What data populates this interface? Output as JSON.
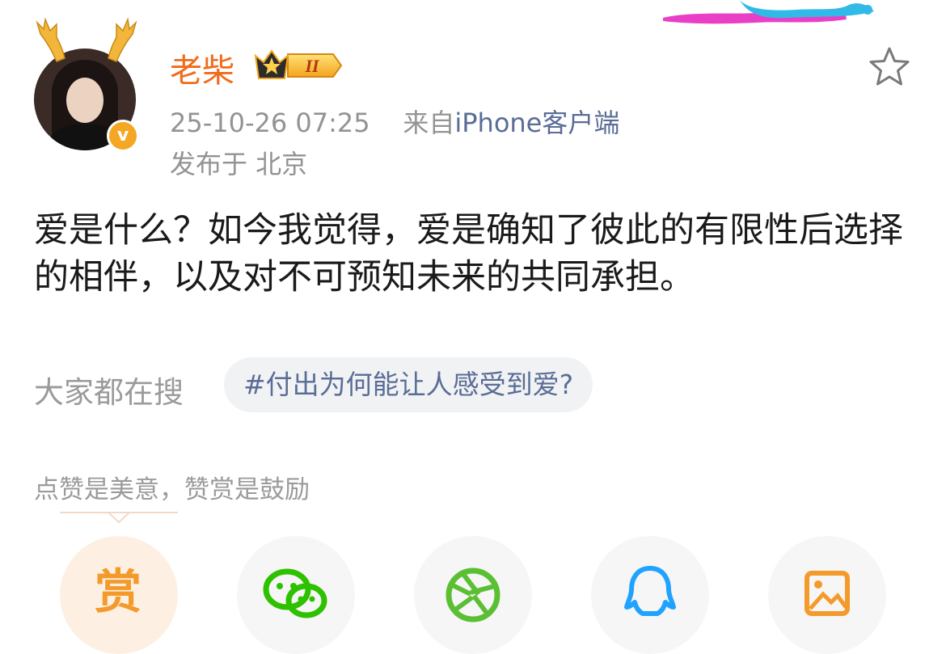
{
  "post": {
    "username": "老柴",
    "vip_level": "II",
    "timestamp": "25-10-26 07:25",
    "from_label": "来自",
    "source": "iPhone客户端",
    "location": "发布于 北京",
    "text": "爱是什么？如今我觉得，爱是确知了彼此的有限性后选择的相伴，以及对不可预知未来的共同承担。"
  },
  "trending": {
    "label": "大家都在搜",
    "tag": "#付出为何能让人感受到爱?"
  },
  "reward": {
    "caption": "点赞是美意，赞赏是鼓励",
    "button_glyph": "赏"
  },
  "colors": {
    "username": "#f06c1b",
    "link": "#5a6d96",
    "secondary_text": "#939393",
    "reward_accent": "#f39a2b",
    "wechat_green": "#2dc100",
    "moments_green": "#5bbf33",
    "qq_blue": "#1fa3ff"
  },
  "icons": [
    "antler-frame-icon",
    "verified-badge-icon",
    "crown-level-icon",
    "favorite-star-icon",
    "reward-icon",
    "wechat-icon",
    "moments-icon",
    "qq-icon",
    "save-image-icon"
  ]
}
